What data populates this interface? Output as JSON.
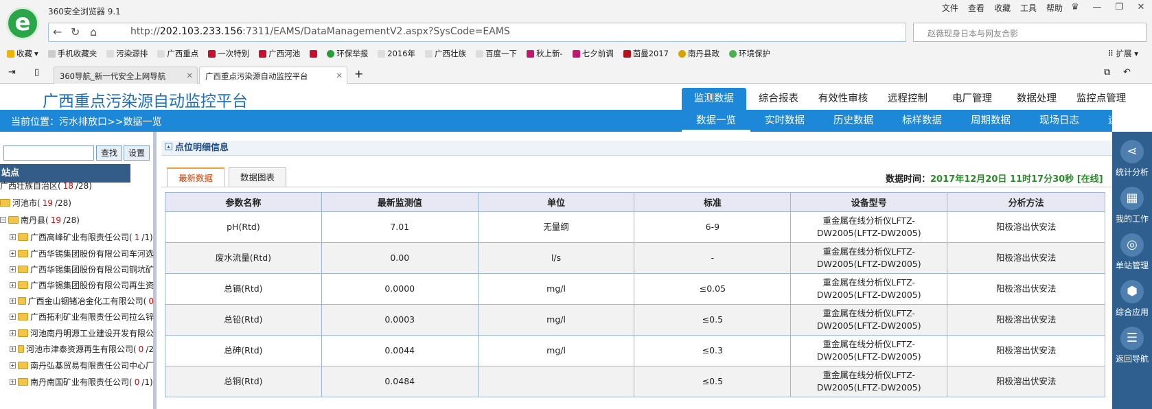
{
  "browser": {
    "app_title": "360安全浏览器 9.1",
    "menu": [
      "文件",
      "查看",
      "收藏",
      "工具",
      "帮助"
    ],
    "url_prefix": "http://",
    "url_host": "202.103.233.156",
    "url_rest": ":7311/EAMS/DataManagementV2.aspx?SysCode=EAMS",
    "search_placeholder": "赵薇现身日本与网友合影",
    "bookmarks": [
      "收藏",
      "手机收藏夹",
      "污染源排",
      "广西重点",
      "一次特别",
      "广西河池",
      "",
      "环保举报",
      "2016年",
      "广西壮族",
      "百度一下",
      "秋上新-",
      "七夕前调",
      "茵曼2017",
      "南丹县政",
      "环境保护"
    ],
    "bookmarks_extend": "扩展",
    "tabs": [
      {
        "label": "360导航_新一代安全上网导航"
      },
      {
        "label": "广西重点污染源自动监控平台"
      }
    ]
  },
  "page": {
    "title": "广西重点污染源自动监控平台",
    "main_nav": [
      "监测数据",
      "综合报表",
      "有效性审核",
      "远程控制",
      "电厂管理",
      "数据处理",
      "监控点管理"
    ],
    "breadcrumb": "当前位置：污水排放口>>数据一览",
    "sub_nav": [
      "数据一览",
      "实时数据",
      "历史数据",
      "标样数据",
      "周期数据",
      "现场日志",
      "运行状态"
    ]
  },
  "sidebar": {
    "find_label": "查找",
    "settings_label": "设置",
    "site_header": "站点",
    "tree": [
      {
        "name": "广西壮族自治区(",
        "a": "18",
        "b": "/28)"
      },
      {
        "name": "河池市(",
        "a": "19",
        "b": "/28)"
      },
      {
        "name": "南丹县(",
        "a": "19",
        "b": "/28)"
      },
      {
        "name": "广西高峰矿业有限责任公司(",
        "a": "1",
        "b": "/1)"
      },
      {
        "name": "广西华锡集团股份有限公司车河选",
        "a": "",
        "b": ""
      },
      {
        "name": "广西华锡集团股份有限公司铜坑矿",
        "a": "",
        "b": ""
      },
      {
        "name": "广西华锡集团股份有限公司再生资",
        "a": "",
        "b": ""
      },
      {
        "name": "广西金山铟锗冶金化工有限公司(",
        "a": "0",
        "b": ""
      },
      {
        "name": "广西拓利矿业有限责任公司拉么锌",
        "a": "",
        "b": ""
      },
      {
        "name": "河池南丹明源工业建设开发有限公",
        "a": "",
        "b": ""
      },
      {
        "name": "河池市津泰资源再生有限公司(",
        "a": "0",
        "b": "/2"
      },
      {
        "name": "南丹弘基贸易有限责任公司中心厂",
        "a": "",
        "b": ""
      },
      {
        "name": "南丹南国矿业有限责任公司(",
        "a": "0",
        "b": "/1)"
      }
    ]
  },
  "panel": {
    "header": "点位明细信息",
    "tabs": [
      "最新数据",
      "数据图表"
    ],
    "data_time_label": "数据时间：",
    "data_time_value": "2017年12月20日 11时17分30秒",
    "status": "[在线]"
  },
  "table": {
    "columns": [
      "参数名称",
      "最新监测值",
      "单位",
      "标准",
      "设备型号",
      "分析方法"
    ],
    "rows": [
      [
        "pH(Rtd)",
        "7.01",
        "无量纲",
        "6-9",
        "重金属在线分析仪LFTZ-DW2005(LFTZ-DW2005)",
        "阳极溶出伏安法"
      ],
      [
        "废水流量(Rtd)",
        "0.00",
        "l/s",
        "-",
        "重金属在线分析仪LFTZ-DW2005(LFTZ-DW2005)",
        "阳极溶出伏安法"
      ],
      [
        "总镉(Rtd)",
        "0.0000",
        "mg/l",
        "≤0.05",
        "重金属在线分析仪LFTZ-DW2005(LFTZ-DW2005)",
        "阳极溶出伏安法"
      ],
      [
        "总铅(Rtd)",
        "0.0003",
        "mg/l",
        "≤0.5",
        "重金属在线分析仪LFTZ-DW2005(LFTZ-DW2005)",
        "阳极溶出伏安法"
      ],
      [
        "总砷(Rtd)",
        "0.0044",
        "mg/l",
        "≤0.3",
        "重金属在线分析仪LFTZ-DW2005(LFTZ-DW2005)",
        "阳极溶出伏安法"
      ],
      [
        "总铜(Rtd)",
        "0.0484",
        "",
        "≤0.5",
        "重金属在线分析仪LFTZ-DW2005(LFTZ-DW2005)",
        "阳极溶出伏安法"
      ]
    ]
  },
  "rail": [
    "统计分析",
    "我的工作",
    "单站管理",
    "综合应用",
    "返回导航"
  ]
}
